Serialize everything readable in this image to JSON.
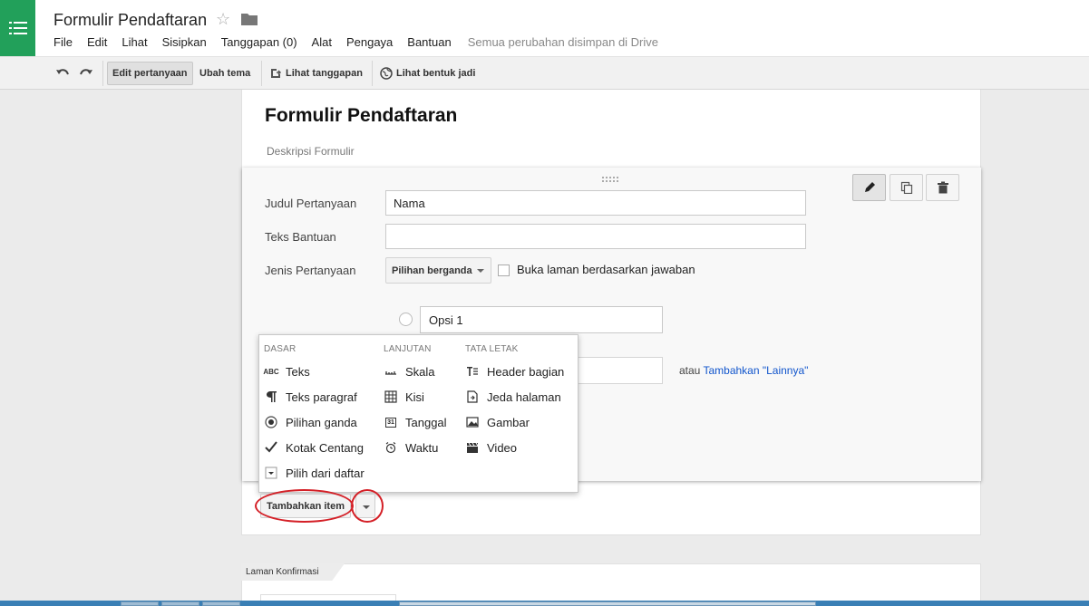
{
  "header": {
    "doc_title": "Formulir Pendaftaran",
    "menu": [
      "File",
      "Edit",
      "Lihat",
      "Sisipkan",
      "Tanggapan (0)",
      "Alat",
      "Pengaya",
      "Bantuan"
    ],
    "save_status": "Semua perubahan disimpan di Drive"
  },
  "toolbar": {
    "edit_questions": "Edit pertanyaan",
    "change_theme": "Ubah tema",
    "view_responses": "Lihat tanggapan",
    "view_live_form": "Lihat bentuk jadi"
  },
  "form": {
    "title": "Formulir Pendaftaran",
    "description": "Deskripsi Formulir"
  },
  "question": {
    "title_label": "Judul Pertanyaan",
    "title_value": "Nama",
    "help_label": "Teks Bantuan",
    "help_value": "",
    "type_label": "Jenis Pertanyaan",
    "type_value": "Pilihan berganda",
    "page_nav_label": "Buka laman berdasarkan jawaban",
    "option1": "Opsi 1",
    "or_text": "atau",
    "add_other_link": "Tambahkan \"Lainnya\""
  },
  "item_menu": {
    "basic_header": "DASAR",
    "advanced_header": "LANJUTAN",
    "layout_header": "TATA LETAK",
    "basic": [
      "Teks",
      "Teks paragraf",
      "Pilihan ganda",
      "Kotak Centang",
      "Pilih dari daftar"
    ],
    "advanced": [
      "Skala",
      "Kisi",
      "Tanggal",
      "Waktu"
    ],
    "layout": [
      "Header bagian",
      "Jeda halaman",
      "Gambar",
      "Video"
    ],
    "text_icon_glyph": "ABC",
    "date_icon_glyph": "31"
  },
  "add_item": {
    "label": "Tambahkan item"
  },
  "confirmation": {
    "tab_label": "Laman Konfirmasi"
  },
  "colors": {
    "brand_green": "#22a05a",
    "link_blue": "#1155cc",
    "annotation_red": "#d42027"
  }
}
